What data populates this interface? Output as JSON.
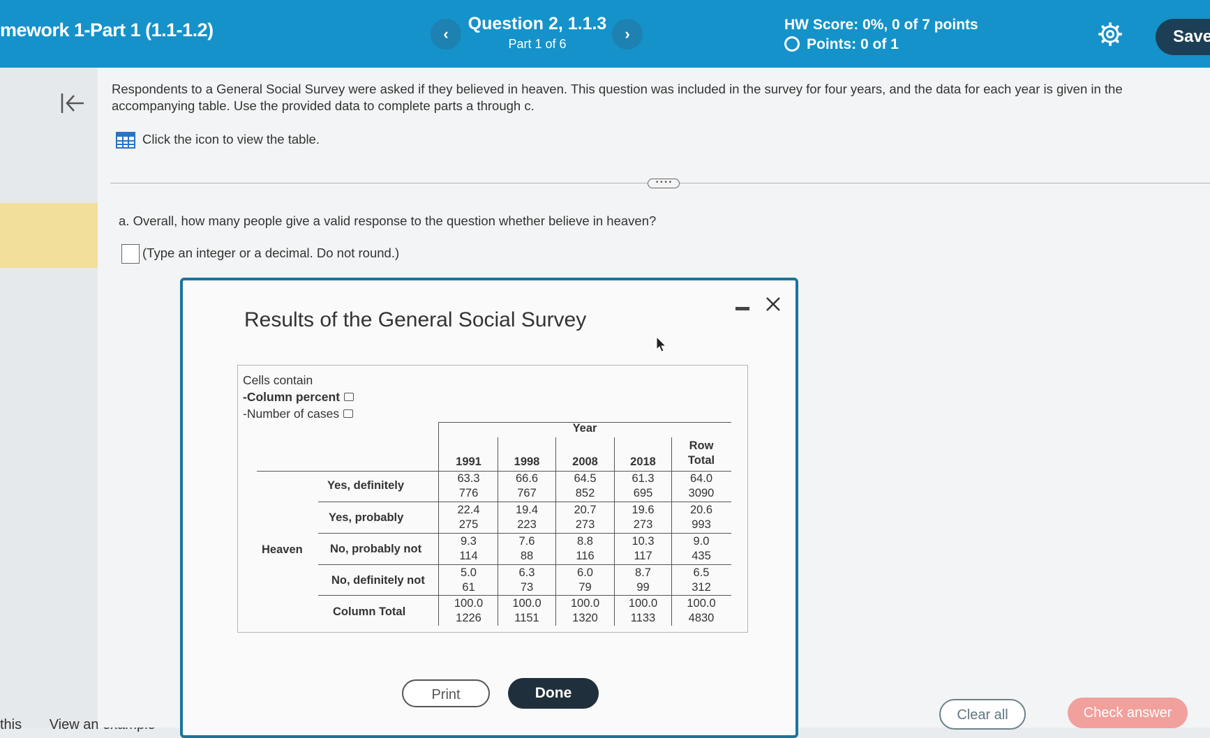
{
  "header": {
    "hw_title": "mework 1-Part 1 (1.1-1.2)",
    "question_title": "Question 2, 1.1.3",
    "question_part": "Part 1 of 6",
    "hw_score": "HW Score: 0%, 0 of 7 points",
    "points": "Points: 0 of 1",
    "save_label": "Save",
    "prev_icon": "‹",
    "next_icon": "›"
  },
  "intro_text": "Respondents to a General Social Survey were asked if they believed in heaven. This question was included in the survey for four years, and the data for each year is given in the accompanying table. Use the provided data to complete parts a through c.",
  "table_link_text": "Click the icon to view the table.",
  "question_a": "a. Overall, how many people give a valid response to the question whether believe in heaven?",
  "answer_hint": "(Type an integer or a decimal. Do not round.)",
  "bottom_left": {
    "left_text": "this",
    "example_text": "View an example"
  },
  "dialog": {
    "title": "Results of the General Social Survey",
    "cells_contain": "Cells contain",
    "column_percent": "-Column percent",
    "number_of_cases": "-Number of cases",
    "year_label": "Year",
    "row_total_line1": "Row",
    "row_total_line2": "Total",
    "group_label": "Heaven",
    "years": [
      "1991",
      "1998",
      "2008",
      "2018"
    ],
    "rows": [
      {
        "label": "Yes, definitely",
        "pct": [
          "63.3",
          "66.6",
          "64.5",
          "61.3",
          "64.0"
        ],
        "n": [
          "776",
          "767",
          "852",
          "695",
          "3090"
        ]
      },
      {
        "label": "Yes, probably",
        "pct": [
          "22.4",
          "19.4",
          "20.7",
          "19.6",
          "20.6"
        ],
        "n": [
          "275",
          "223",
          "273",
          "273",
          "993"
        ]
      },
      {
        "label": "No, probably not",
        "pct": [
          "9.3",
          "7.6",
          "8.8",
          "10.3",
          "9.0"
        ],
        "n": [
          "114",
          "88",
          "116",
          "117",
          "435"
        ]
      },
      {
        "label": "No, definitely not",
        "pct": [
          "5.0",
          "6.3",
          "6.0",
          "8.7",
          "6.5"
        ],
        "n": [
          "61",
          "73",
          "79",
          "99",
          "312"
        ]
      },
      {
        "label": "Column Total",
        "pct": [
          "100.0",
          "100.0",
          "100.0",
          "100.0",
          "100.0"
        ],
        "n": [
          "1226",
          "1151",
          "1320",
          "1133",
          "4830"
        ]
      }
    ],
    "print_label": "Print",
    "done_label": "Done"
  },
  "footer": {
    "clear_label": "Clear all",
    "check_label": "Check answer"
  },
  "colors": {
    "header_bg": "#1592c9",
    "save_bg": "#1c3f55",
    "dialog_border": "#19759b",
    "done_bg": "#1f2f3c",
    "check_bg": "#f1a09c",
    "highlight": "#f2df9c"
  }
}
